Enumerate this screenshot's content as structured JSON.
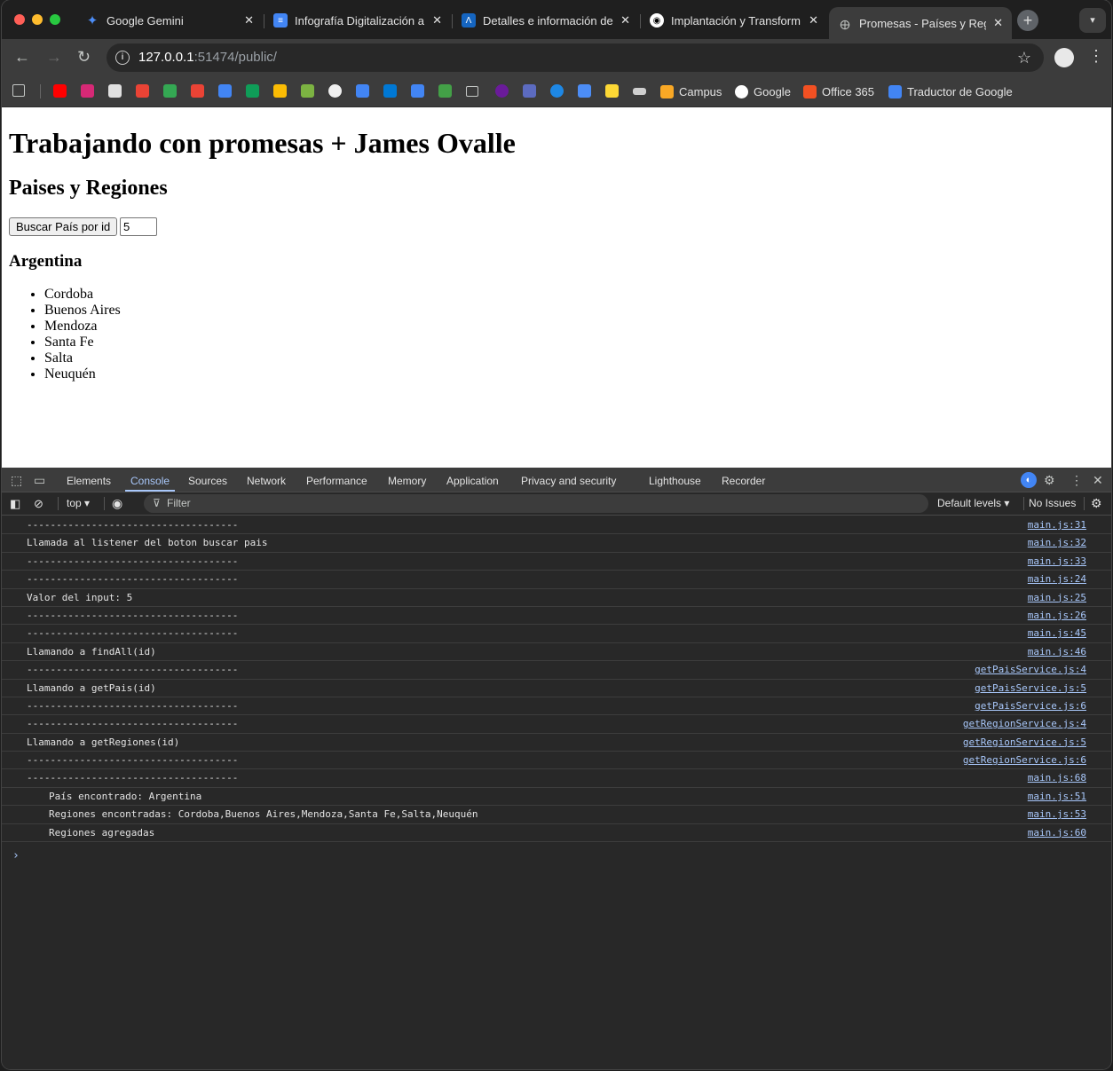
{
  "browser": {
    "tabs": [
      {
        "title": "Google Gemini",
        "fav": "gemini-icon",
        "color": "#1a73e8",
        "active": false
      },
      {
        "title": "Infografía Digitalización a",
        "fav": "docs-icon",
        "color": "#4285f4",
        "active": false
      },
      {
        "title": "Detalles e información de",
        "fav": "app-icon",
        "color": "#1565c0",
        "active": false
      },
      {
        "title": "Implantación y Transform",
        "fav": "circle-icon",
        "color": "#ffffff",
        "active": false
      },
      {
        "title": "Promesas - Países y Regi",
        "fav": "globe-icon",
        "color": "#9aa0a6",
        "active": true
      }
    ],
    "url_host": "127.0.0.1",
    "url_rest": ":51474/public/",
    "bookmarks": [
      {
        "label": "Campus",
        "color": "#f9a825"
      },
      {
        "label": "Google",
        "color": "#ffffff"
      },
      {
        "label": "Office 365",
        "color": "#f25022"
      },
      {
        "label": "Traductor de Google",
        "color": "#4285f4"
      }
    ]
  },
  "page": {
    "title": "Trabajando con promesas + James Ovalle",
    "subtitle": "Paises y Regiones",
    "search_button": "Buscar País por id",
    "id_value": "5",
    "country": "Argentina",
    "regions": [
      "Cordoba",
      "Buenos Aires",
      "Mendoza",
      "Santa Fe",
      "Salta",
      "Neuquén"
    ]
  },
  "devtools": {
    "tabs": [
      "Elements",
      "Console",
      "Sources",
      "Network",
      "Performance",
      "Memory",
      "Application",
      "Privacy and security",
      "Lighthouse",
      "Recorder"
    ],
    "active_tab": "Console",
    "context": "top ▾",
    "filter_placeholder": "Filter",
    "levels": "Default levels ▾",
    "issues": "No Issues",
    "logs": [
      {
        "msg": "------------------------------------",
        "src": "main.js:31",
        "indent": false
      },
      {
        "msg": "Llamada al listener del boton buscar pais",
        "src": "main.js:32",
        "indent": false
      },
      {
        "msg": "------------------------------------",
        "src": "main.js:33",
        "indent": false
      },
      {
        "msg": "------------------------------------",
        "src": "main.js:24",
        "indent": false
      },
      {
        "msg": "Valor del input: 5",
        "src": "main.js:25",
        "indent": false
      },
      {
        "msg": "------------------------------------",
        "src": "main.js:26",
        "indent": false
      },
      {
        "msg": "------------------------------------",
        "src": "main.js:45",
        "indent": false
      },
      {
        "msg": "Llamando a findAll(id)",
        "src": "main.js:46",
        "indent": false
      },
      {
        "msg": "------------------------------------",
        "src": "getPaisService.js:4",
        "indent": false
      },
      {
        "msg": "Llamando a getPais(id)",
        "src": "getPaisService.js:5",
        "indent": false
      },
      {
        "msg": "------------------------------------",
        "src": "getPaisService.js:6",
        "indent": false
      },
      {
        "msg": "------------------------------------",
        "src": "getRegionService.js:4",
        "indent": false
      },
      {
        "msg": "Llamando a getRegiones(id)",
        "src": "getRegionService.js:5",
        "indent": false
      },
      {
        "msg": "------------------------------------",
        "src": "getRegionService.js:6",
        "indent": false
      },
      {
        "msg": "------------------------------------",
        "src": "main.js:68",
        "indent": false
      },
      {
        "msg": "País encontrado: Argentina",
        "src": "main.js:51",
        "indent": true
      },
      {
        "msg": "Regiones encontradas: Cordoba,Buenos Aires,Mendoza,Santa Fe,Salta,Neuquén",
        "src": "main.js:53",
        "indent": true
      },
      {
        "msg": "Regiones agregadas",
        "src": "main.js:60",
        "indent": true
      }
    ],
    "prompt": "›"
  }
}
